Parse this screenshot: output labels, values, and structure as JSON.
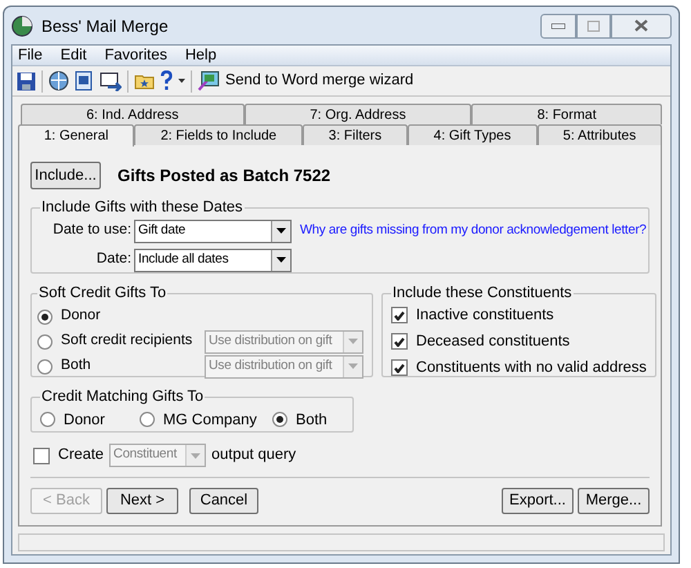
{
  "window": {
    "title": "Bess' Mail Merge"
  },
  "menu": [
    "File",
    "Edit",
    "Favorites",
    "Help"
  ],
  "toolbar": {
    "wizard_label": "Send to Word merge wizard"
  },
  "tabs": [
    [
      {
        "label": "6: Ind. Address",
        "selected": false
      },
      {
        "label": "7: Org. Address",
        "selected": false
      },
      {
        "label": "8: Format",
        "selected": false
      }
    ],
    [
      {
        "label": "1: General",
        "selected": true
      },
      {
        "label": "2: Fields to Include",
        "selected": false
      },
      {
        "label": "3: Filters",
        "selected": false
      },
      {
        "label": "4: Gift Types",
        "selected": false
      },
      {
        "label": "5: Attributes",
        "selected": false
      }
    ]
  ],
  "include_button": "Include...",
  "batch_label": "Gifts Posted as Batch 7522",
  "dates_group": {
    "title": "Include Gifts with these Dates",
    "fields": [
      {
        "label": "Date to use:",
        "value": "Gift date"
      },
      {
        "label": "Date:",
        "value": "Include all dates"
      }
    ],
    "help_link": "Why are gifts missing from my donor acknowledgement letter?"
  },
  "soft_credit": {
    "title": "Soft Credit Gifts To",
    "options": [
      {
        "label": "Donor",
        "selected": true
      },
      {
        "label": "Soft credit recipients",
        "selected": false,
        "dropdown": {
          "value": "Use distribution on gift",
          "disabled": true
        }
      },
      {
        "label": "Both",
        "selected": false,
        "dropdown": {
          "value": "Use distribution on gift",
          "disabled": true
        }
      }
    ]
  },
  "constituents": {
    "title": "Include these Constituents",
    "items": [
      {
        "label": "Inactive constituents",
        "checked": true
      },
      {
        "label": "Deceased constituents",
        "checked": true
      },
      {
        "label": "Constituents with no valid address",
        "checked": true
      }
    ]
  },
  "matching": {
    "title": "Credit Matching Gifts To",
    "options": [
      {
        "label": "Donor",
        "selected": false
      },
      {
        "label": "MG Company",
        "selected": false
      },
      {
        "label": "Both",
        "selected": true
      }
    ]
  },
  "create_query": {
    "checked": false,
    "label": "Create",
    "dropdown": {
      "value": "Constituent",
      "disabled": true
    },
    "suffix": "output query"
  },
  "buttons": [
    {
      "label": "< Back",
      "disabled": true
    },
    {
      "label": "Next >",
      "disabled": false
    },
    {
      "label": "Cancel",
      "disabled": false
    },
    {
      "label": "Export...",
      "disabled": false
    },
    {
      "label": "Merge...",
      "disabled": false
    }
  ]
}
